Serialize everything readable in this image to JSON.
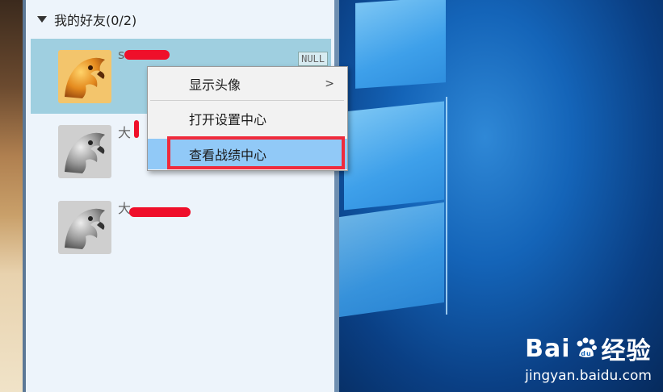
{
  "friend_group": {
    "label": "我的好友(0/2)"
  },
  "friends": [
    {
      "name_prefix": "s",
      "tag": "NULL"
    },
    {
      "name_prefix": "大"
    },
    {
      "name_prefix": "大"
    }
  ],
  "context_menu": {
    "items": [
      {
        "label": "显示头像",
        "submenu_arrow": ">"
      },
      {
        "label": "打开设置中心"
      },
      {
        "label": "查看战绩中心"
      }
    ]
  },
  "watermark": {
    "logo_text": "Bai",
    "logo_suffix": "经验",
    "url": "jingyan.baidu.com"
  },
  "colors": {
    "highlight": "#91c9f7",
    "callout_border": "#ef2b3c",
    "redaction": "#ef0f2a",
    "selected_row": "#9fcfe0"
  }
}
